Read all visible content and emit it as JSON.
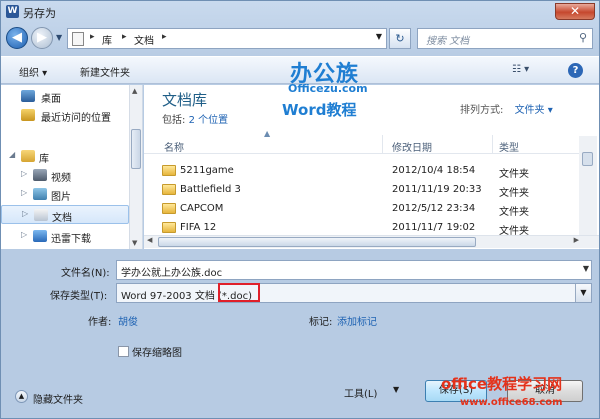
{
  "window": {
    "title": "另存为",
    "close": "✕"
  },
  "nav": {
    "back": "◀",
    "forward": "▶",
    "breadcrumb": [
      "库",
      "文档"
    ],
    "search_placeholder": "搜索 文档"
  },
  "toolbar": {
    "organize": "组织 ▾",
    "new_folder": "新建文件夹",
    "views": "☷ ▾",
    "help": "?"
  },
  "sidebar": {
    "items": [
      {
        "label": "桌面",
        "icon": "desktop-icon"
      },
      {
        "label": "最近访问的位置",
        "icon": "recent-places-icon"
      },
      {
        "label": "库",
        "icon": "library-icon"
      },
      {
        "label": "视频",
        "icon": "video-icon"
      },
      {
        "label": "图片",
        "icon": "pictures-icon"
      },
      {
        "label": "文档",
        "icon": "documents-icon"
      },
      {
        "label": "迅雷下载",
        "icon": "thunder-download-icon"
      }
    ]
  },
  "library": {
    "title": "文档库",
    "includes_label": "包括:",
    "includes_link": "2 个位置",
    "arrange_label": "排列方式:",
    "arrange_value": "文件夹 ▾"
  },
  "table": {
    "columns": [
      "名称",
      "修改日期",
      "类型"
    ],
    "rows": [
      {
        "name": "5211game",
        "date": "2012/10/4 18:54",
        "type": "文件夹"
      },
      {
        "name": "Battlefield 3",
        "date": "2011/11/19 20:33",
        "type": "文件夹"
      },
      {
        "name": "CAPCOM",
        "date": "2012/5/12 23:34",
        "type": "文件夹"
      },
      {
        "name": "FIFA 12",
        "date": "2011/11/7 19:02",
        "type": "文件夹"
      }
    ]
  },
  "watermark": {
    "logo": "办公族",
    "site": "Officezu.com",
    "tagline": "Word教程",
    "corner": "office教程学习网",
    "corner_url": "www.office68.com"
  },
  "form": {
    "filename_label": "文件名(N):",
    "filename_value": "学办公就上办公族.doc",
    "filetype_label": "保存类型(T):",
    "filetype_value": "Word 97-2003 文档 (*.doc)",
    "author_label": "作者:",
    "author_value": "胡俊",
    "tags_label": "标记:",
    "tags_value": "添加标记",
    "thumbnail_label": "保存缩略图",
    "thumbnail_checked": false,
    "hide_folders": "隐藏文件夹",
    "tools": "工具(L)",
    "save": "保存(S)",
    "cancel": "取消"
  }
}
